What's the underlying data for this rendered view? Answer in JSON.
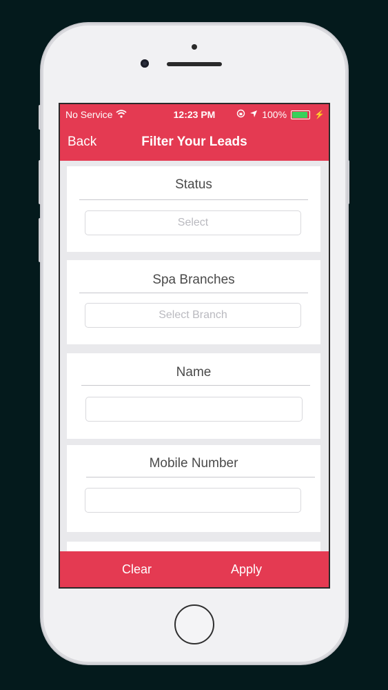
{
  "status_bar": {
    "carrier": "No Service",
    "time": "12:23 PM",
    "battery": "100%"
  },
  "nav": {
    "back_label": "Back",
    "title": "Filter Your Leads"
  },
  "filters": {
    "status": {
      "label": "Status",
      "placeholder": "Select"
    },
    "spa_branches": {
      "label": "Spa Branches",
      "placeholder": "Select Branch"
    },
    "name": {
      "label": "Name",
      "value": ""
    },
    "mobile": {
      "label": "Mobile Number",
      "value": ""
    }
  },
  "actions": {
    "clear_label": "Clear",
    "apply_label": "Apply"
  },
  "colors": {
    "accent": "#e43a52",
    "background": "#e9e9ec",
    "battery": "#37d15a"
  }
}
